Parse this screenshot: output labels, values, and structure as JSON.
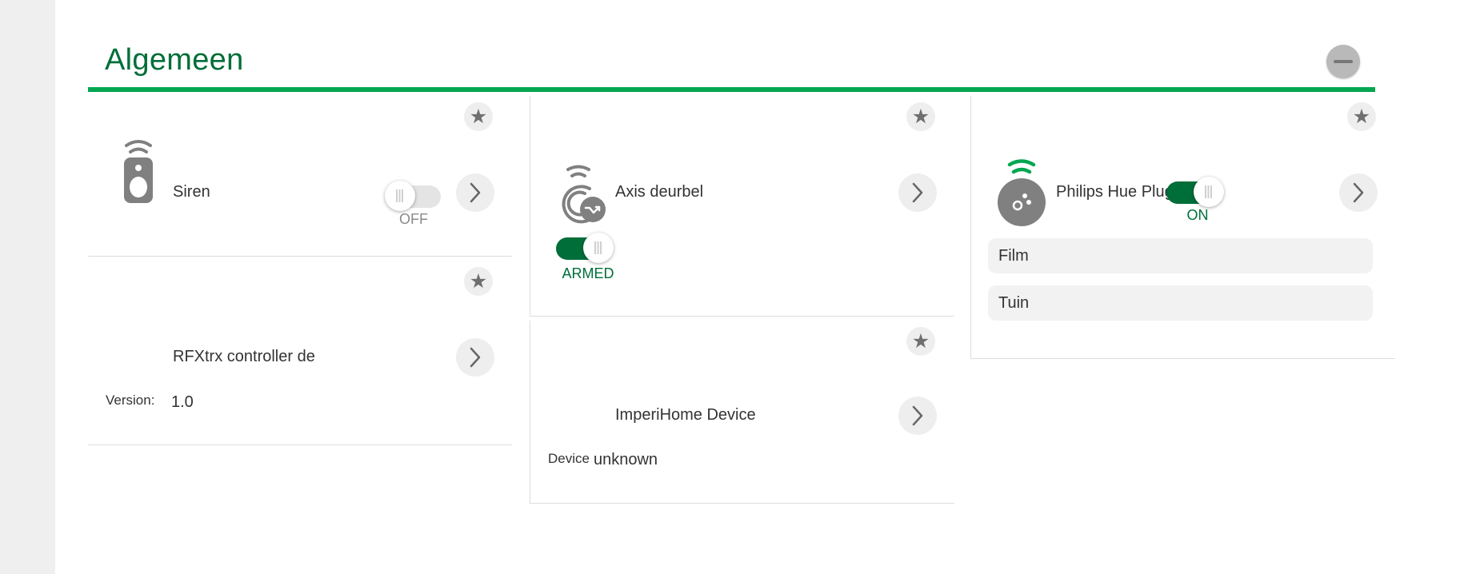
{
  "section": {
    "title": "Algemeen"
  },
  "colors": {
    "brand_green": "#006e39",
    "accent_green": "#00a650",
    "button_gray": "#eeeeee"
  },
  "devices": {
    "siren": {
      "name": "Siren",
      "toggle_state": "OFF",
      "icon": "siren-remote-icon"
    },
    "rfx": {
      "name": "RFXtrx controller de",
      "version_label": "Version:",
      "version_value": "1.0"
    },
    "axis": {
      "name": "Axis deurbel",
      "toggle_state": "ARMED",
      "icon": "doorbell-sensor-icon"
    },
    "imperihome": {
      "name": "ImperiHome Device",
      "device_label": "Device",
      "device_value": "unknown"
    },
    "hue": {
      "name": "Philips Hue Plugin",
      "toggle_state": "ON",
      "icon": "hue-bridge-icon",
      "scenes": [
        "Film",
        "Tuin"
      ]
    }
  },
  "icons": {
    "favorite": "star-icon",
    "details": "chevron-right-icon",
    "collapse": "minus-icon"
  }
}
